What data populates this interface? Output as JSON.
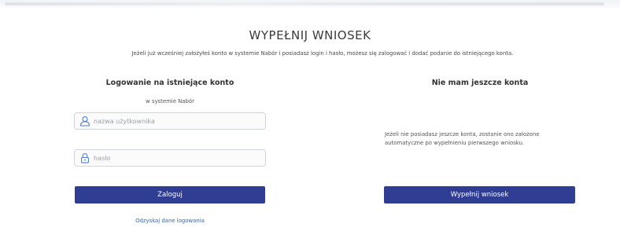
{
  "header": {
    "title": "WYPEŁNIJ WNIOSEK",
    "subtitle": "Jeżeli już wcześniej założyłeś konto w systemie Nabór i posiadasz login i hasło, możesz się zalogować i dodać podanie do istniejącego konta."
  },
  "login": {
    "heading": "Logowanie na istniejące konto",
    "subheading": "w systemie Nabór",
    "username_placeholder": "nazwa użytkownika",
    "username_value": "",
    "password_placeholder": "hasło",
    "password_value": "",
    "submit_label": "Zaloguj",
    "recover_link": "Odzyskaj dane logowania"
  },
  "register": {
    "heading": "Nie mam jeszcze konta",
    "info_line1": "Jeżeli nie posiadasz jeszcze konta, zostanie ono założone",
    "info_line2": "automatyczne po wypełnieniu pierwszego wniosku.",
    "submit_label": "Wypełnij wniosek"
  },
  "colors": {
    "primary_button": "#2f3d92",
    "link": "#3c62a8",
    "icon": "#4f7fd1"
  },
  "icons": {
    "user": "user-icon",
    "lock": "lock-icon"
  }
}
